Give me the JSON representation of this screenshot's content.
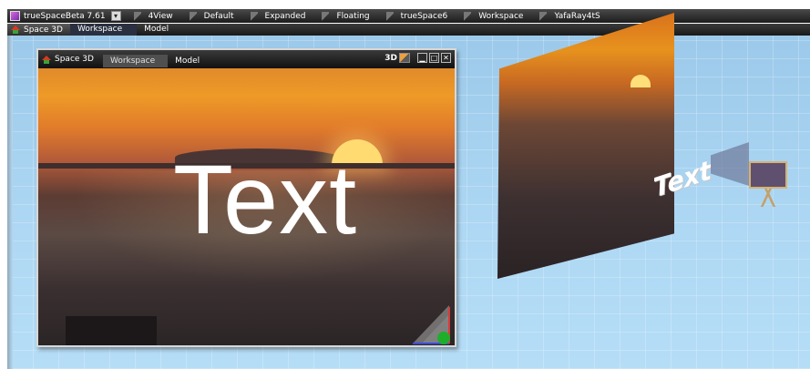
{
  "app": {
    "title": "trueSpaceBeta 7.61",
    "layout_dropdown_symbol": "▾",
    "layouts": [
      "4View",
      "Default",
      "Expanded",
      "Floating",
      "trueSpace6",
      "Workspace",
      "YafaRay4tS"
    ]
  },
  "secondary_bar": {
    "space_label": "Space 3D",
    "tabs": [
      "Workspace",
      "Model"
    ]
  },
  "viewport_window": {
    "title": "Space 3D",
    "tabs": [
      "Workspace",
      "Model"
    ],
    "mode_label": "3D",
    "minimize_symbol": "▁",
    "maximize_symbol": "□",
    "close_symbol": "✕",
    "content_text": "Text"
  },
  "scene": {
    "text_object": "Text"
  },
  "colors": {
    "workspace_floor": "#aed8f4",
    "sunset_orange": "#ee9a27",
    "sun": "#ffdb72",
    "camera_body": "#5f5070"
  }
}
